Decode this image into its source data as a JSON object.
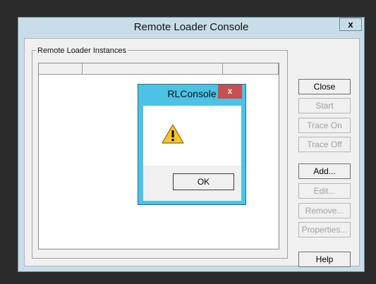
{
  "window": {
    "title": "Remote Loader Console",
    "close_glyph": "x",
    "group_label": "Remote Loader Instances"
  },
  "buttons": {
    "close": "Close",
    "start": "Start",
    "trace_on": "Trace On",
    "trace_off": "Trace Off",
    "add": "Add...",
    "edit": "Edit...",
    "remove": "Remove...",
    "properties": "Properties...",
    "help": "Help"
  },
  "dialog": {
    "title": "RLConsole",
    "close_glyph": "x",
    "icon": "warning-icon",
    "ok": "OK"
  },
  "colors": {
    "window_frame": "#c8dde8",
    "dialog_frame": "#4cc2e4",
    "dialog_close": "#c75050",
    "warning_yellow": "#f7c52b"
  }
}
